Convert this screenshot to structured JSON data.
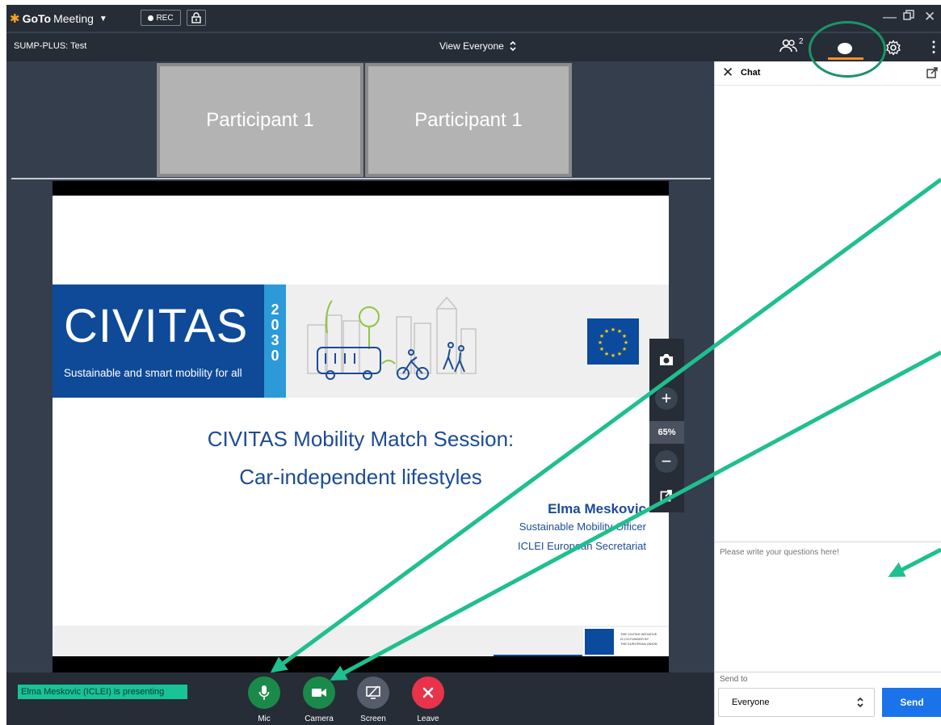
{
  "app": {
    "logo_prefix": "GoTo",
    "logo_suffix": "Meeting",
    "rec_label": "REC"
  },
  "session": {
    "title": "SUMP-PLUS: Test",
    "view_label": "View Everyone",
    "attendee_count": "2"
  },
  "participants": [
    {
      "name": "Participant 1"
    },
    {
      "name": "Participant 1"
    }
  ],
  "slide": {
    "logo_text": "CIVITAS",
    "logo_tagline": "Sustainable and smart mobility for all",
    "logo_year": [
      "2",
      "0",
      "3",
      "0"
    ],
    "title_line1": "CIVITAS Mobility Match Session:",
    "title_line2": "Car-independent lifestyles",
    "speaker_name": "Elma Meskovic",
    "speaker_role": "Sustainable Mobility Officer",
    "speaker_org": "ICLEI European Secretariat",
    "footer_lines": [
      "THE CIVITAS INITIATIVE",
      "IS CO-FUNDED BY",
      "THE EUROPEAN UNION"
    ]
  },
  "zoom": {
    "level": "65%"
  },
  "status": {
    "presenting": "Elma Meskovic (ICLEI) is presenting"
  },
  "controls": {
    "mic": "Mic",
    "camera": "Camera",
    "screen": "Screen",
    "leave": "Leave"
  },
  "chat": {
    "title": "Chat",
    "input_placeholder": "Please write your questions here!",
    "send_to_label": "Send to",
    "send_to_value": "Everyone",
    "send_label": "Send"
  },
  "colors": {
    "accent_orange": "#f68d2e",
    "annotation_green": "#1fbf8f",
    "mic_green": "#1a8a4a",
    "leave_red": "#e8334a",
    "send_blue": "#1a73e8",
    "civitas_blue": "#0e4a97"
  },
  "icons": [
    "gotomeeting-logo-icon",
    "record-dot-icon",
    "lock-icon",
    "minimize-icon",
    "restore-icon",
    "close-icon",
    "people-icon",
    "chat-bubble-icon",
    "gear-icon",
    "more-vertical-icon",
    "chevron-updown-icon",
    "camera-snapshot-icon",
    "zoom-in-icon",
    "zoom-out-icon",
    "popout-icon",
    "mic-icon",
    "video-icon",
    "screen-share-off-icon",
    "leave-x-icon",
    "annotation-arrow-icon"
  ]
}
